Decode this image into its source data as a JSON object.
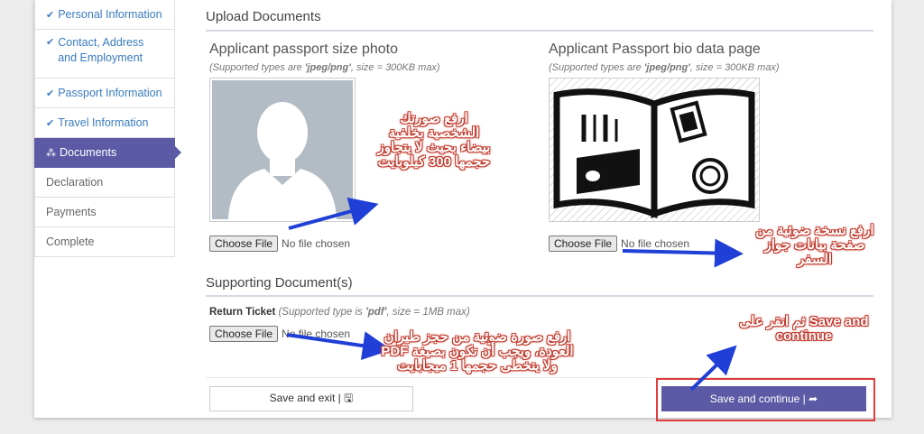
{
  "sidebar": {
    "items": [
      {
        "label": "Personal Information",
        "state": "done"
      },
      {
        "label": "Contact, Address and Employment",
        "state": "done"
      },
      {
        "label": "Passport Information",
        "state": "done"
      },
      {
        "label": "Travel Information",
        "state": "done"
      },
      {
        "label": "Documents",
        "state": "active"
      },
      {
        "label": "Declaration",
        "state": "pending"
      },
      {
        "label": "Payments",
        "state": "pending"
      },
      {
        "label": "Complete",
        "state": "pending"
      }
    ]
  },
  "upload": {
    "title": "Upload Documents",
    "photo": {
      "label": "Applicant passport size photo",
      "hint_prefix": "(Supported types are ",
      "hint_types": "'jpeg/png'",
      "hint_suffix": ", size = 300KB max)",
      "choose_label": "Choose File",
      "status": "No file chosen"
    },
    "bio": {
      "label": "Applicant Passport bio data page",
      "hint_prefix": "(Supported types are ",
      "hint_types": "'jpeg/png'",
      "hint_suffix": ", size = 300KB max)",
      "choose_label": "Choose File",
      "status": "No file chosen"
    }
  },
  "supporting": {
    "title": "Supporting Document(s)",
    "ticket": {
      "label": "Return Ticket",
      "hint_prefix": " (Supported type is ",
      "hint_types": "'pdf'",
      "hint_suffix": ", size = 1MB max)",
      "choose_label": "Choose File",
      "status": "No file chosen"
    }
  },
  "actions": {
    "save_exit": "Save and exit | 🖫",
    "save_continue": "Save and continue | ➦"
  },
  "annotations": {
    "photo_note": "ارفع صورتك الشخصية بخلفية بيضاء بحيث لا يتجاوز حجمها 300 كيلوبايت",
    "bio_note": "ارفع نسخة ضوئية من صفحة بيانات جواز السفر",
    "ticket_note": "ارفع صورة ضوئية من حجز طيران العودة، ويجب أن تكون بصيغة PDF ولا يتخطى حجمها 1 ميجابايت",
    "save_note": "Save and ثم انقر على continue"
  },
  "colors": {
    "accent": "#5c5aa5",
    "link": "#3a7bbf",
    "highlight": "#e23b3b",
    "arrow": "#1f3fd6"
  }
}
